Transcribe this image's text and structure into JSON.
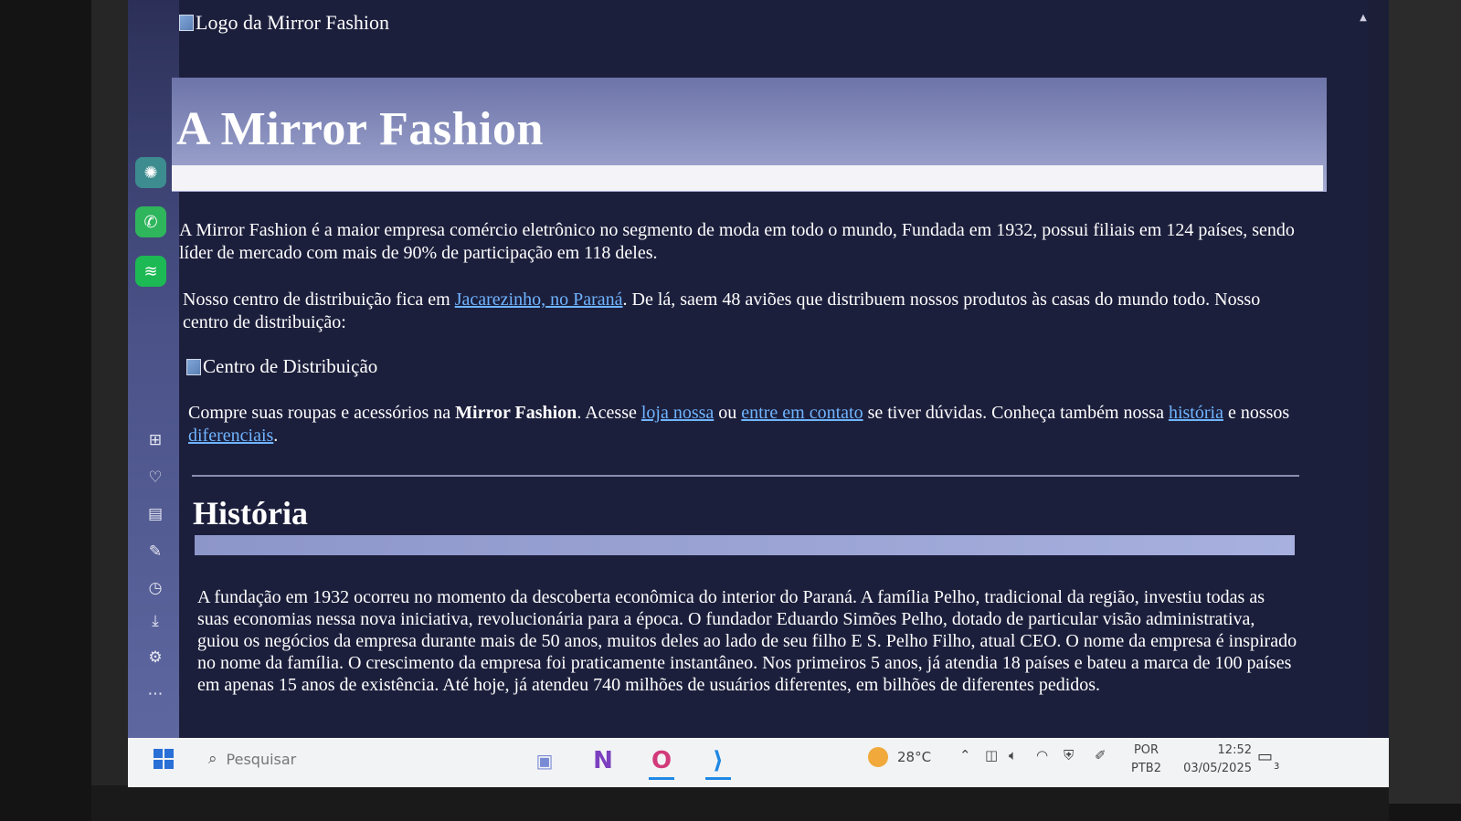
{
  "logo": {
    "alt_text": "Logo da Mirror Fashion"
  },
  "header": {
    "title": "A Mirror Fashion"
  },
  "intro": {
    "text": "A Mirror Fashion é a maior empresa comércio eletrônico no segmento de moda em todo o mundo, Fundada em 1932, possui filiais em 124 países, sendo líder de mercado com mais de 90% de participação em 118 deles."
  },
  "distribution": {
    "text_before": "Nosso centro de distribuição fica em ",
    "link": "Jacarezinho, no Paraná",
    "text_after": ". De lá, saem 48 aviões que distribuem nossos produtos às casas do mundo todo. Nosso centro de distribuição:",
    "image_alt": "Centro de Distribuição"
  },
  "cta": {
    "text1": "Compre suas roupas e acessórios na ",
    "brand": "Mirror Fashion",
    "text2": ". Acesse ",
    "link_store": "loja nossa",
    "text3": " ou ",
    "link_contact": "entre em contato",
    "text4": " se tiver dúvidas. Conheça também nossa ",
    "link_history": "história",
    "text5": " e nossos ",
    "link_features": "diferenciais",
    "text6": "."
  },
  "historia": {
    "title": "História",
    "text": "A fundação em 1932 ocorreu no momento da descoberta econômica do interior do Paraná. A família Pelho, tradicional da região, investiu todas as suas economias nessa nova iniciativa, revolucionária para a época. O fundador Eduardo Simões Pelho, dotado de particular visão administrativa, guiou os negócios da empresa durante mais de 50 anos, muitos deles ao lado de seu filho E S. Pelho Filho, atual CEO. O nome da empresa é inspirado no nome da família. O crescimento da empresa foi praticamente instantâneo. Nos primeiros 5 anos, já atendia 18 países e bateu a marca de 100 países em apenas 15 anos de existência. Até hoje, já atendeu 740 milhões de usuários diferentes, em bilhões de diferentes pedidos."
  },
  "sidebar": {
    "apps": [
      {
        "name": "chatgpt",
        "icon": "chatgpt-icon",
        "color": "#10a37f"
      },
      {
        "name": "whatsapp",
        "icon": "whatsapp-icon",
        "color": "#25d366"
      },
      {
        "name": "spotify",
        "icon": "spotify-icon",
        "color": "#1db954"
      }
    ],
    "tools": [
      "apps-grid-icon",
      "heart-icon",
      "news-icon",
      "edit-icon",
      "history-icon",
      "download-icon",
      "settings-icon",
      "more-icon"
    ]
  },
  "taskbar": {
    "search_placeholder": "Pesquisar",
    "weather": "28°C",
    "lang_line1": "POR",
    "lang_line2": "PTB2",
    "time": "12:52",
    "date": "03/05/2025",
    "notifications": "3"
  },
  "colors": {
    "page_bg": "#1c1f3c",
    "link": "#6fb4ff",
    "header_bg": "#8e95c2"
  }
}
